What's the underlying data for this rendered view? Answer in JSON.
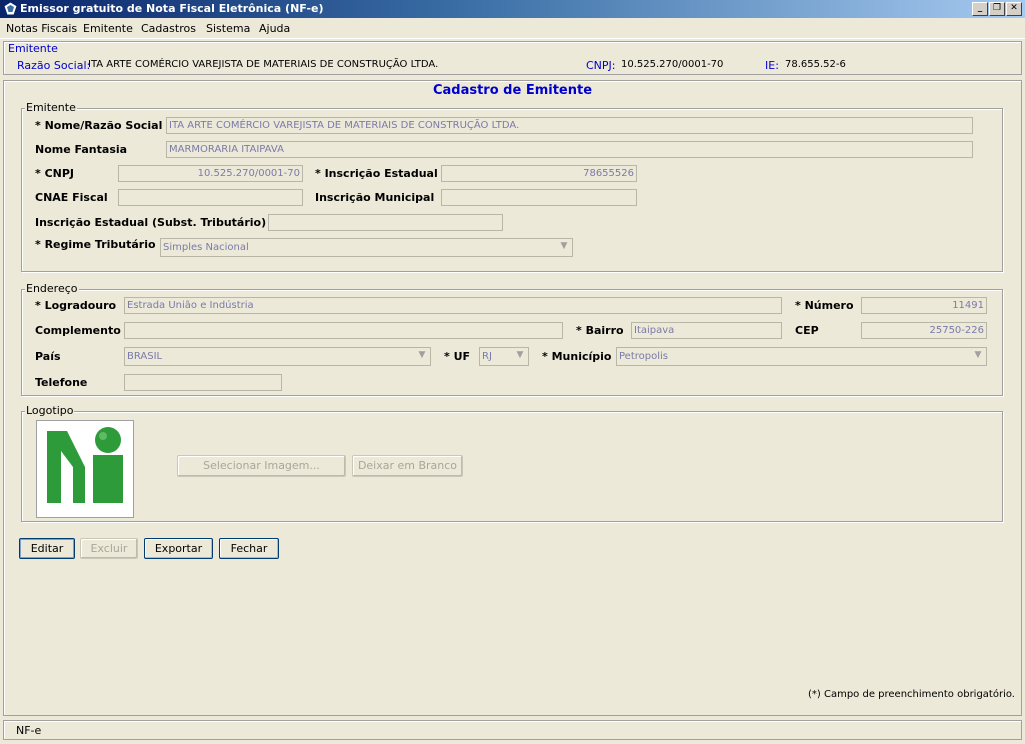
{
  "window": {
    "title": "Emissor gratuito de Nota Fiscal Eletrônica (NF-e)",
    "minimize": "_",
    "restore": "❐",
    "close": "✕"
  },
  "menu": [
    "Notas Fiscais",
    "Emitente",
    "Cadastros",
    "Sistema",
    "Ajuda"
  ],
  "header": {
    "group_label": "Emitente",
    "razao_label": "Razão Social:",
    "razao_value": "ITA ARTE COMÉRCIO VAREJISTA DE MATERIAIS DE CONSTRUÇÃO LTDA.",
    "cnpj_label": "CNPJ:",
    "cnpj_value": "10.525.270/0001-70",
    "ie_label": "IE:",
    "ie_value": "78.655.52-6"
  },
  "form": {
    "title": "Cadastro de Emitente",
    "emitente": {
      "legend": "Emitente",
      "nome_label": "* Nome/Razão Social",
      "nome_value": "ITA ARTE COMÉRCIO VAREJISTA DE MATERIAIS DE CONSTRUÇÃO LTDA.",
      "fantasia_label": "Nome Fantasia",
      "fantasia_value": "MARMORARIA ITAIPAVA",
      "cnpj_label": "* CNPJ",
      "cnpj_value": "10.525.270/0001-70",
      "ie_label": "* Inscrição Estadual",
      "ie_value": "78655526",
      "cnae_label": "CNAE Fiscal",
      "cnae_value": "",
      "im_label": "Inscrição Municipal",
      "im_value": "",
      "iest_label": "Inscrição Estadual (Subst. Tributário)",
      "iest_value": "",
      "regime_label": "* Regime Tributário",
      "regime_value": "Simples Nacional"
    },
    "endereco": {
      "legend": "Endereço",
      "logradouro_label": "* Logradouro",
      "logradouro_value": "Estrada União e Indústria",
      "numero_label": "* Número",
      "numero_value": "11491",
      "complemento_label": "Complemento",
      "complemento_value": "",
      "bairro_label": "* Bairro",
      "bairro_value": "Itaipava",
      "cep_label": "CEP",
      "cep_value": "25750-226",
      "pais_label": "País",
      "pais_value": "BRASIL",
      "uf_label": "* UF",
      "uf_value": "RJ",
      "municipio_label": "* Município",
      "municipio_value": "Petropolis",
      "telefone_label": "Telefone",
      "telefone_value": ""
    },
    "logotipo": {
      "legend": "Logotipo",
      "select_button": "Selecionar Imagem...",
      "blank_button": "Deixar em Branco"
    },
    "buttons": {
      "editar": "Editar",
      "excluir": "Excluir",
      "exportar": "Exportar",
      "fechar": "Fechar"
    },
    "footnote": "(*) Campo de preenchimento obrigatório."
  },
  "status": "NF-e",
  "colors": {
    "accent": "#0000CC",
    "logo_green": "#2E9B3A"
  }
}
